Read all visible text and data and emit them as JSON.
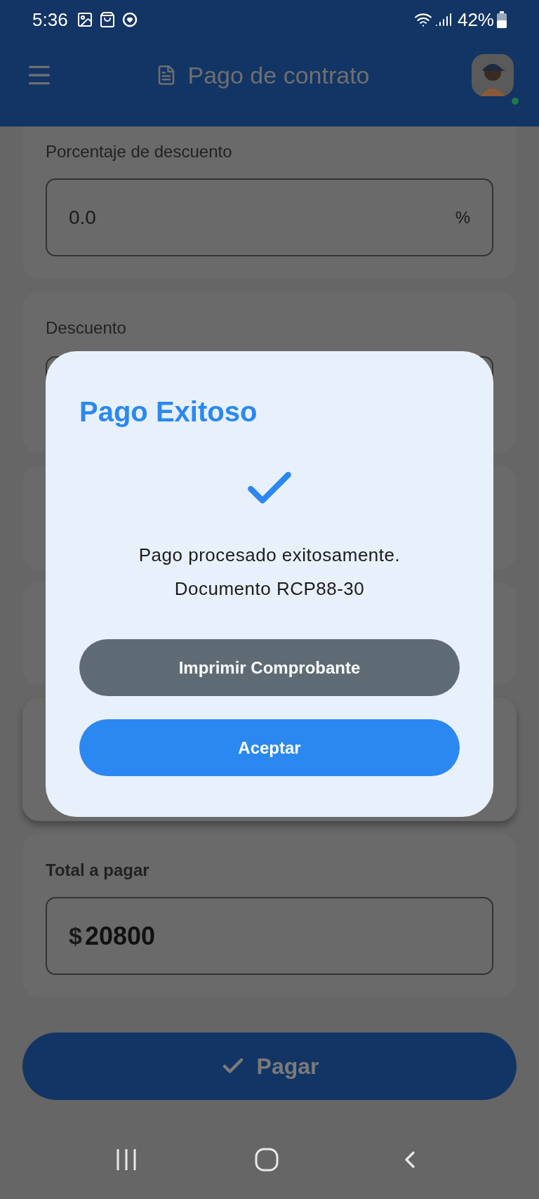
{
  "status_bar": {
    "time": "5:36",
    "battery": "42%"
  },
  "header": {
    "title": "Pago de contrato",
    "avatar": {
      "online": true
    }
  },
  "fields": [
    {
      "label": "Porcentaje de descuento",
      "value": "0.0",
      "suffix": "%"
    },
    {
      "label": "Descuento"
    }
  ],
  "total": {
    "label": "Total a pagar",
    "currency": "$",
    "value": "20800"
  },
  "pay_button": {
    "label": "Pagar"
  },
  "dialog": {
    "title": "Pago Exitoso",
    "message": [
      "Pago procesado exitosamente.",
      "Documento RCP88-30"
    ],
    "buttons": [
      {
        "label": "Imprimir Comprobante",
        "kind": "secondary"
      },
      {
        "label": "Aceptar",
        "kind": "primary"
      }
    ]
  }
}
